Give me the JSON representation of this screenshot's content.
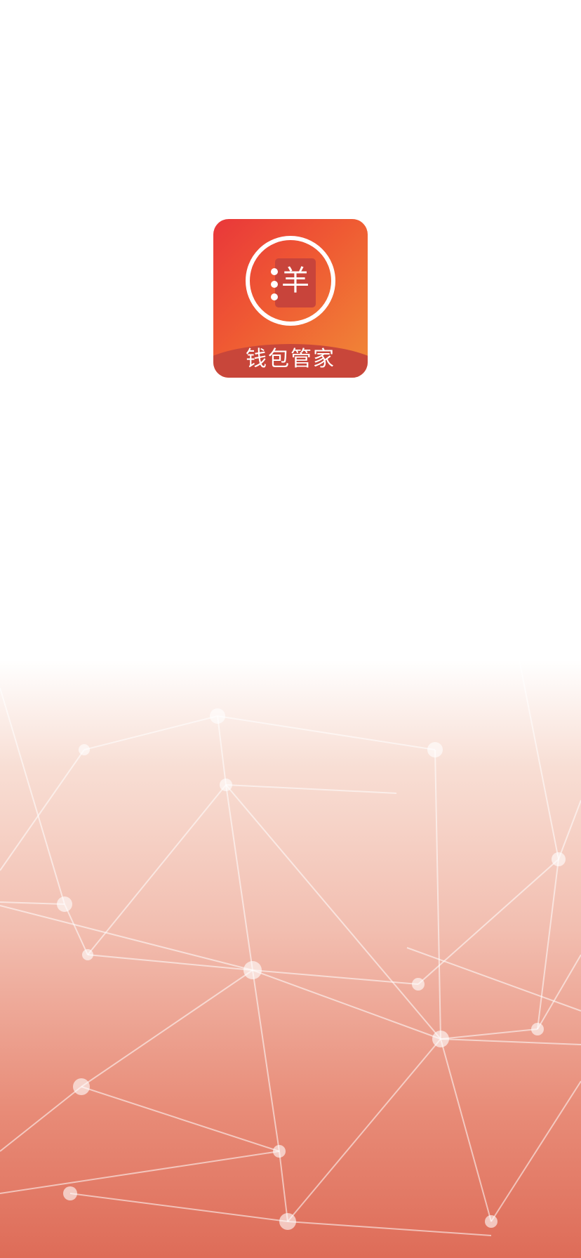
{
  "app": {
    "name": "钱包管家",
    "icon_symbol": "羊",
    "icon_name": "wallet-book-icon"
  },
  "colors": {
    "icon_gradient_start": "#e9373a",
    "icon_gradient_end": "#f08a37",
    "icon_band": "#c8463a",
    "background_bottom": "#de6c58"
  }
}
